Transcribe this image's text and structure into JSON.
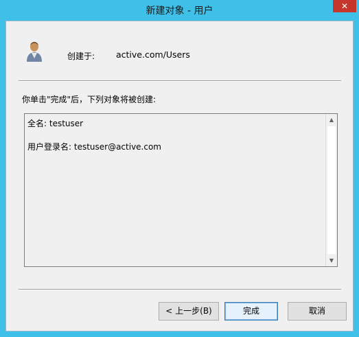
{
  "window": {
    "title": "新建对象 - 用户",
    "close_glyph": "✕"
  },
  "header": {
    "created_in_label": "创建于:",
    "created_in_path": "active.com/Users",
    "icon": "user-icon"
  },
  "instruction": "你单击\"完成\"后，下列对象将被创建:",
  "summary": {
    "lines": [
      "全名: testuser",
      "",
      "用户登录名: testuser@active.com"
    ],
    "scroll_up_glyph": "▲",
    "scroll_down_glyph": "▼"
  },
  "buttons": {
    "back": "< 上一步(B)",
    "finish": "完成",
    "cancel": "取消"
  },
  "colors": {
    "titlebar": "#3fc0e8",
    "close": "#c7362c",
    "client": "#f0f0f0"
  }
}
